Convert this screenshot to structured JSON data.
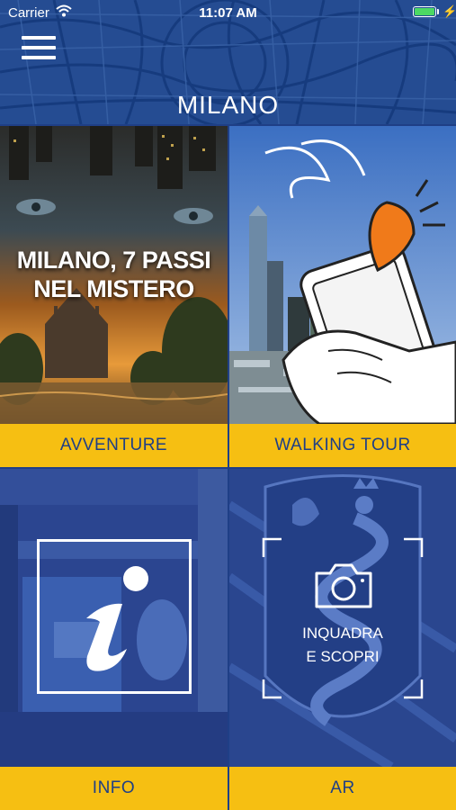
{
  "status_bar": {
    "carrier": "Carrier",
    "time": "11:07 AM",
    "battery_level": 1.0
  },
  "header": {
    "title": "MILANO",
    "menu_icon": "hamburger-menu-icon"
  },
  "tiles": [
    {
      "id": "avventure",
      "label": "AVVENTURE",
      "poster_title_line1": "MILANO, 7 PASSI",
      "poster_title_line2": "NEL MISTERO"
    },
    {
      "id": "walking-tour",
      "label": "WALKING TOUR"
    },
    {
      "id": "info",
      "label": "INFO",
      "icon": "info-icon"
    },
    {
      "id": "ar",
      "label": "AR",
      "icon": "camera-icon",
      "caption_line1": "INQUADRA",
      "caption_line2": "E SCOPRI"
    }
  ],
  "colors": {
    "header_blue": "#254c92",
    "label_yellow": "#f6bf12",
    "label_text": "#1f3f86",
    "pin_orange": "#f07a1a"
  }
}
